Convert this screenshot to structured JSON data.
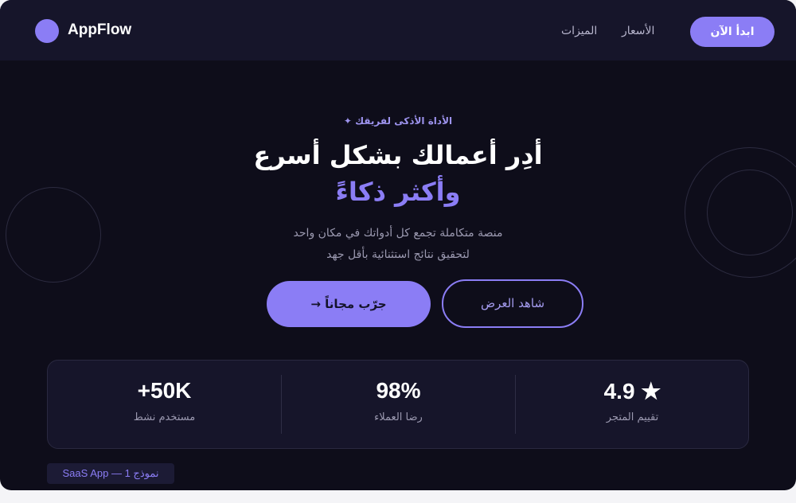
{
  "header": {
    "brand": "AppFlow",
    "nav": {
      "features": "الميزات",
      "pricing": "الأسعار"
    },
    "cta": "ابدأ الآن"
  },
  "hero": {
    "tagline": "الأداة الأذكى لفريقك ✦",
    "title_line1": "أدِر أعمالك بشكل أسرع",
    "title_line2": "وأكثر ذكاءً",
    "subtitle_line1": "منصة متكاملة تجمع كل أدواتك في مكان واحد",
    "subtitle_line2": "لتحقيق نتائج استثنائية بأقل جهد",
    "primary_button": "جرّب مجاناً →",
    "secondary_button": "شاهد العرض"
  },
  "stats": [
    {
      "value": "+50K",
      "label": "مستخدم نشط"
    },
    {
      "value": "98%",
      "label": "رضا العملاء"
    },
    {
      "value": "4.9 ★",
      "label": "تقييم المتجر"
    }
  ],
  "badge": "SaaS App — نموذج 1",
  "colors": {
    "accent": "#8b7df5",
    "background": "#0e0d1a",
    "header": "#16152a"
  }
}
